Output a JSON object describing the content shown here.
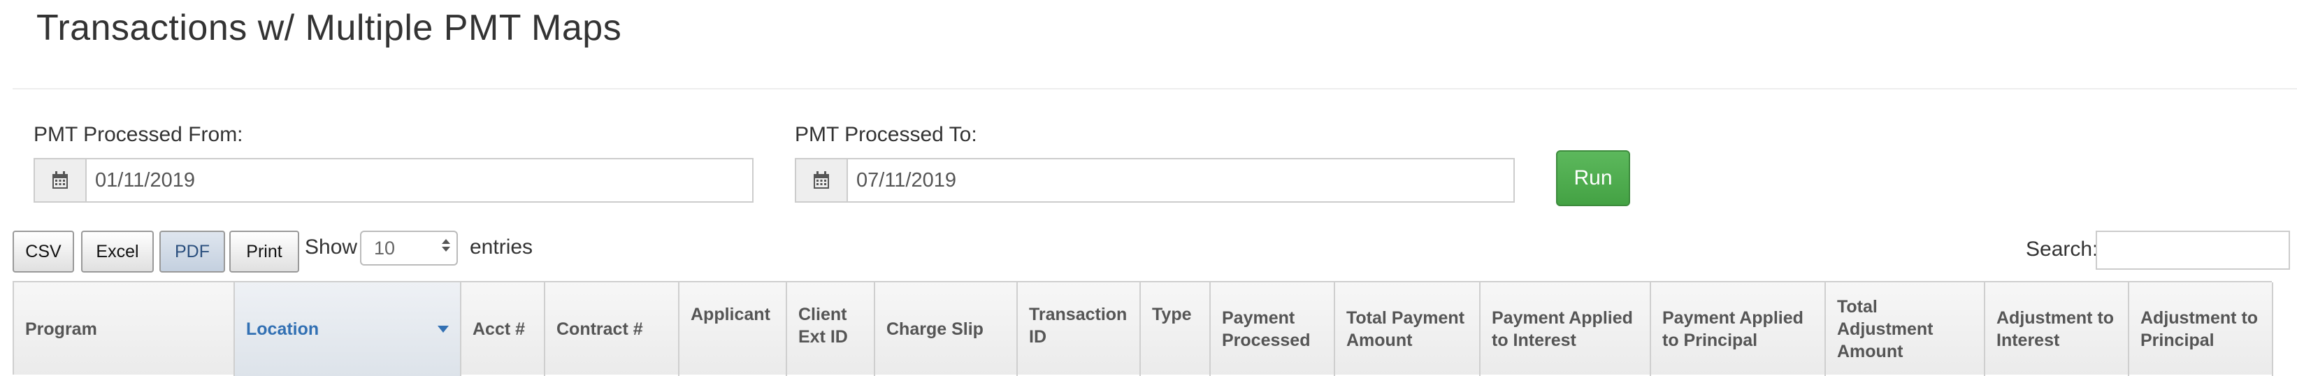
{
  "page": {
    "title": "Transactions w/ Multiple PMT Maps"
  },
  "filters": {
    "from": {
      "label": "PMT Processed From:",
      "value": "01/11/2019",
      "icon": "calendar-icon"
    },
    "to": {
      "label": "PMT Processed To:",
      "value": "07/11/2019",
      "icon": "calendar-icon"
    },
    "run_label": "Run",
    "run_color": "#5cb85c"
  },
  "export": {
    "csv": "CSV",
    "excel": "Excel",
    "pdf": "PDF",
    "print": "Print"
  },
  "length": {
    "show": "Show",
    "value": "10",
    "entries": "entries"
  },
  "search": {
    "label": "Search:",
    "value": ""
  },
  "table": {
    "sorted_column": "Location",
    "sort_color": "#3270b3",
    "columns": [
      "Program",
      "Location",
      "Acct #",
      "Contract #",
      "Applicant",
      "Client Ext ID",
      "Charge Slip",
      "Transaction ID",
      "Type",
      "Payment Processed",
      "Total Payment Amount",
      "Payment Applied to Interest",
      "Payment Applied to Principal",
      "Total Adjustment Amount",
      "Adjustment to Interest",
      "Adjustment to Principal"
    ]
  }
}
